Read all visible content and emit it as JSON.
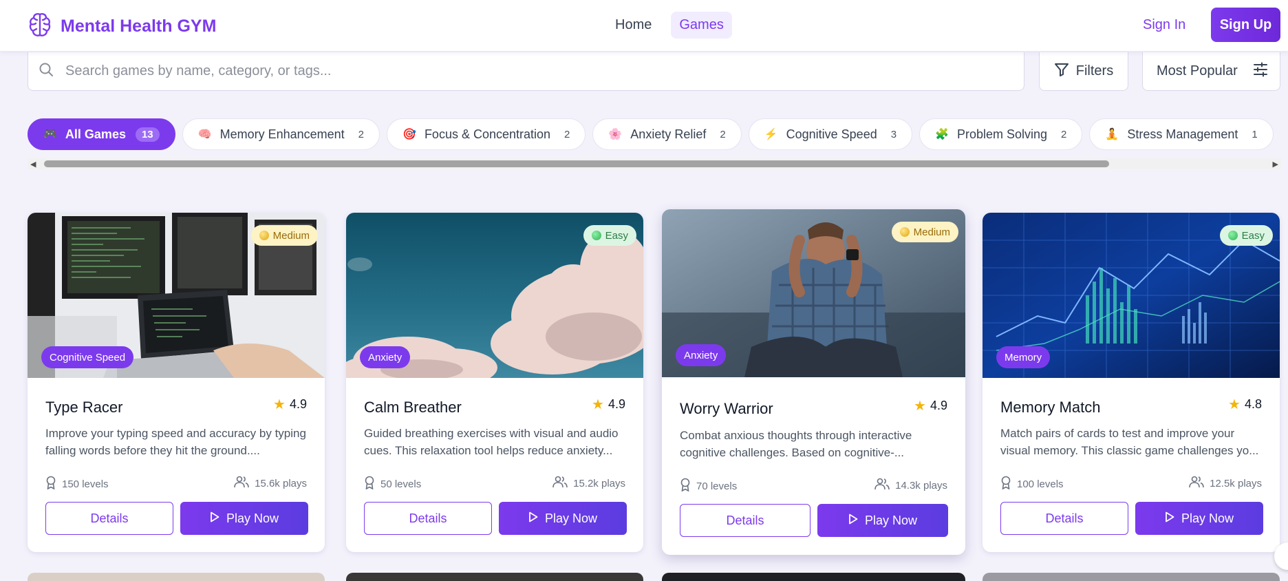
{
  "app": {
    "name": "Mental Health GYM",
    "brand_color": "#7c3aed"
  },
  "nav": {
    "items": [
      {
        "label": "Home",
        "active": false
      },
      {
        "label": "Games",
        "active": true
      }
    ],
    "signin_label": "Sign In",
    "signup_label": "Sign Up"
  },
  "search": {
    "placeholder": "Search games by name, category, or tags...",
    "value": ""
  },
  "toolbar": {
    "filters_label": "Filters",
    "sort_value": "Most Popular"
  },
  "categories": [
    {
      "label": "All Games",
      "count": "13",
      "icon": "gamepad-icon",
      "active": true
    },
    {
      "label": "Memory Enhancement",
      "count": "2",
      "icon": "brain-icon",
      "active": false
    },
    {
      "label": "Focus & Concentration",
      "count": "2",
      "icon": "target-icon",
      "active": false
    },
    {
      "label": "Anxiety Relief",
      "count": "2",
      "icon": "flower-icon",
      "active": false
    },
    {
      "label": "Cognitive Speed",
      "count": "3",
      "icon": "lightning-icon",
      "active": false
    },
    {
      "label": "Problem Solving",
      "count": "2",
      "icon": "puzzle-icon",
      "active": false
    },
    {
      "label": "Stress Management",
      "count": "1",
      "icon": "meditation-icon",
      "active": false
    }
  ],
  "games": [
    {
      "title": "Type Racer",
      "difficulty": "Medium",
      "category": "Cognitive Speed",
      "rating": "4.9",
      "description": "Improve your typing speed and accuracy by typing falling words before they hit the ground....",
      "levels": "150 levels",
      "plays": "15.6k plays",
      "details_label": "Details",
      "play_label": "Play Now"
    },
    {
      "title": "Calm Breather",
      "difficulty": "Easy",
      "category": "Anxiety",
      "rating": "4.9",
      "description": "Guided breathing exercises with visual and audio cues. This relaxation tool helps reduce anxiety...",
      "levels": "50 levels",
      "plays": "15.2k plays",
      "details_label": "Details",
      "play_label": "Play Now"
    },
    {
      "title": "Worry Warrior",
      "difficulty": "Medium",
      "category": "Anxiety",
      "rating": "4.9",
      "description": "Combat anxious thoughts through interactive cognitive challenges. Based on cognitive-...",
      "levels": "70 levels",
      "plays": "14.3k plays",
      "details_label": "Details",
      "play_label": "Play Now"
    },
    {
      "title": "Memory Match",
      "difficulty": "Easy",
      "category": "Memory",
      "rating": "4.8",
      "description": "Match pairs of cards to test and improve your visual memory. This classic game challenges yo...",
      "levels": "100 levels",
      "plays": "12.5k plays",
      "details_label": "Details",
      "play_label": "Play Now"
    }
  ]
}
